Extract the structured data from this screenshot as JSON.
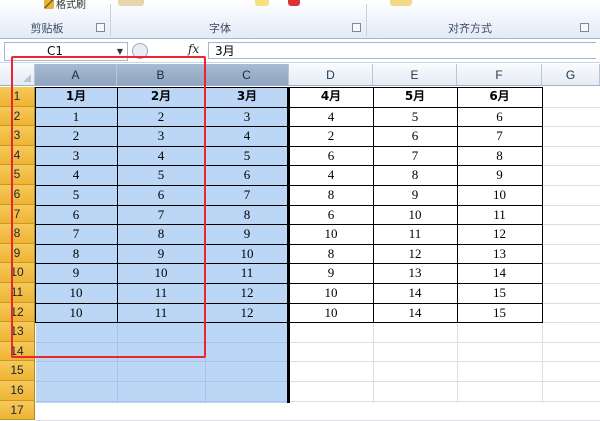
{
  "ribbon": {
    "paint_format_label": "格式刷",
    "groups": [
      {
        "label": "剪贴板"
      },
      {
        "label": "字体"
      },
      {
        "label": "对齐方式"
      }
    ]
  },
  "formula_bar": {
    "name_box": "C1",
    "formula_text": "3月",
    "fx_label": "fx"
  },
  "sheet": {
    "columns": [
      "A",
      "B",
      "C",
      "D",
      "E",
      "F",
      "G"
    ],
    "selected_columns": [
      "A",
      "B",
      "C"
    ],
    "row_numbers": [
      "1",
      "2",
      "3",
      "4",
      "5",
      "6",
      "7",
      "8",
      "9",
      "10",
      "11",
      "12",
      "13",
      "14",
      "15",
      "16",
      "17"
    ],
    "header_row": [
      "1月",
      "2月",
      "3月",
      "4月",
      "5月",
      "6月"
    ],
    "data_rows": [
      [
        "1",
        "2",
        "3",
        "4",
        "5",
        "6"
      ],
      [
        "2",
        "3",
        "4",
        "2",
        "6",
        "7"
      ],
      [
        "3",
        "4",
        "5",
        "6",
        "7",
        "8"
      ],
      [
        "4",
        "5",
        "6",
        "4",
        "8",
        "9"
      ],
      [
        "5",
        "6",
        "7",
        "8",
        "9",
        "10"
      ],
      [
        "6",
        "7",
        "8",
        "6",
        "10",
        "11"
      ],
      [
        "7",
        "8",
        "9",
        "10",
        "11",
        "12"
      ],
      [
        "8",
        "9",
        "10",
        "8",
        "12",
        "13"
      ],
      [
        "9",
        "10",
        "11",
        "9",
        "13",
        "14"
      ],
      [
        "10",
        "11",
        "12",
        "10",
        "14",
        "15"
      ],
      [
        "10",
        "11",
        "12",
        "10",
        "14",
        "15"
      ]
    ]
  },
  "colors": {
    "selection": "#60a0e6",
    "annotation_box": "#ea2630",
    "row_header": "#f0b83a"
  }
}
